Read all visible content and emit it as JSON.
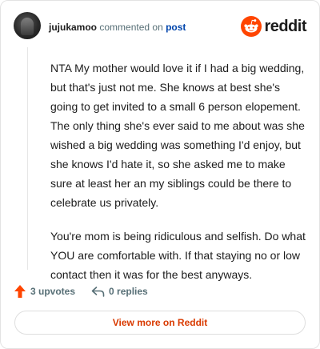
{
  "header": {
    "username": "jujukamoo",
    "commented_text": "commented on",
    "post_link": "post",
    "logo_text": "reddit"
  },
  "comment": {
    "paragraphs": [
      "NTA My mother would love it if I had a big wedding, but that's just not me. She knows at best she's going to get invited to a small 6 person elopement. The only thing she's ever said to me about was she wished a big wedding was something I'd enjoy, but she knows I'd hate it, so she asked me to make sure at least her an my siblings could be there to celebrate us privately.",
      "You're mom is being ridiculous and selfish. Do what YOU are comfortable with. If that staying no or low contact then it was for the best anyways."
    ]
  },
  "footer": {
    "upvotes": "3 upvotes",
    "replies": "0 replies"
  },
  "view_more_label": "View more on Reddit",
  "colors": {
    "brand": "#ff4500",
    "link": "#0045ac",
    "view_more": "#d93a00"
  }
}
